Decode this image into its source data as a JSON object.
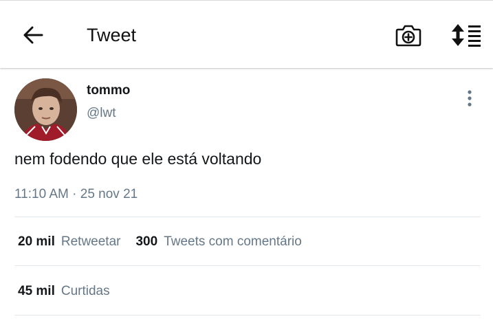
{
  "header": {
    "title": "Tweet",
    "back_icon": "arrow-left-icon",
    "camera_icon": "camera-plus-icon",
    "sort_icon": "sort-list-icon"
  },
  "tweet": {
    "display_name": "tommo",
    "handle": "@lwt",
    "text": "nem fodendo que ele está voltando",
    "time": "11:10 AM",
    "separator": "·",
    "date": "25 nov 21"
  },
  "stats": {
    "retweets_count": "20 mil",
    "retweets_label": "Retweetar",
    "quotes_count": "300",
    "quotes_label": "Tweets com comentário",
    "likes_count": "45 mil",
    "likes_label": "Curtidas"
  },
  "colors": {
    "text_primary": "#14171a",
    "text_secondary": "#657786",
    "divider": "#e1e8ed"
  }
}
